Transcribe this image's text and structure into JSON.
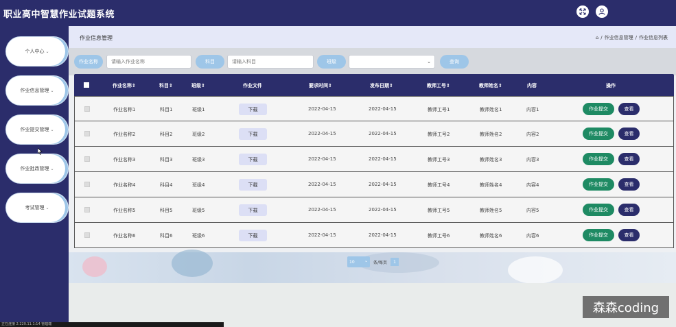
{
  "app": {
    "title": "职业高中智慧作业试题系统"
  },
  "topbar": {
    "fullscreen_icon": "expand-icon",
    "user_icon": "user-icon"
  },
  "sidebar": {
    "items": [
      {
        "label": "个人中心"
      },
      {
        "label": "作业信息管理"
      },
      {
        "label": "作业提交管理"
      },
      {
        "label": "作业批改管理"
      },
      {
        "label": "考试管理"
      }
    ]
  },
  "header": {
    "page_title": "作业信息管理",
    "breadcrumb": [
      "作业信息管理",
      "作业信息列表"
    ]
  },
  "search": {
    "name_label": "作业名称",
    "name_placeholder": "请输入作业名称",
    "subject_label": "科目",
    "subject_placeholder": "请输入科目",
    "class_label": "班级",
    "class_value": "",
    "query_label": "查询"
  },
  "table": {
    "headers": [
      "作业名称",
      "科目",
      "班级",
      "作业文件",
      "要求时间",
      "发布日期",
      "教师工号",
      "教师姓名",
      "内容",
      "操作"
    ],
    "download_label": "下载",
    "submit_label": "作业提交",
    "view_label": "查看",
    "rows": [
      {
        "name": "作业名称1",
        "subject": "科目1",
        "class": "班级1",
        "due": "2022-04-15",
        "published": "2022-04-15",
        "teacher_id": "教师工号1",
        "teacher_name": "教师姓名1",
        "content": "内容1"
      },
      {
        "name": "作业名称2",
        "subject": "科目2",
        "class": "班级2",
        "due": "2022-04-15",
        "published": "2022-04-15",
        "teacher_id": "教师工号2",
        "teacher_name": "教师姓名2",
        "content": "内容2"
      },
      {
        "name": "作业名称3",
        "subject": "科目3",
        "class": "班级3",
        "due": "2022-04-15",
        "published": "2022-04-15",
        "teacher_id": "教师工号3",
        "teacher_name": "教师姓名3",
        "content": "内容3"
      },
      {
        "name": "作业名称4",
        "subject": "科目4",
        "class": "班级4",
        "due": "2022-04-15",
        "published": "2022-04-15",
        "teacher_id": "教师工号4",
        "teacher_name": "教师姓名4",
        "content": "内容4"
      },
      {
        "name": "作业名称5",
        "subject": "科目5",
        "class": "班级5",
        "due": "2022-04-15",
        "published": "2022-04-15",
        "teacher_id": "教师工号5",
        "teacher_name": "教师姓名5",
        "content": "内容5"
      },
      {
        "name": "作业名称6",
        "subject": "科目6",
        "class": "班级6",
        "due": "2022-04-15",
        "published": "2022-04-15",
        "teacher_id": "教师工号6",
        "teacher_name": "教师姓名6",
        "content": "内容6"
      }
    ]
  },
  "pager": {
    "page_size": "10",
    "per_page_label": "条/每页",
    "current_page": "1"
  },
  "overlay": {
    "watermark": "森森coding",
    "status_text": "正在连接 2.220.11.1:14 管理端"
  },
  "colors": {
    "primary": "#2b2d6b",
    "accent": "#9ec6e8",
    "success": "#1e8a63"
  }
}
